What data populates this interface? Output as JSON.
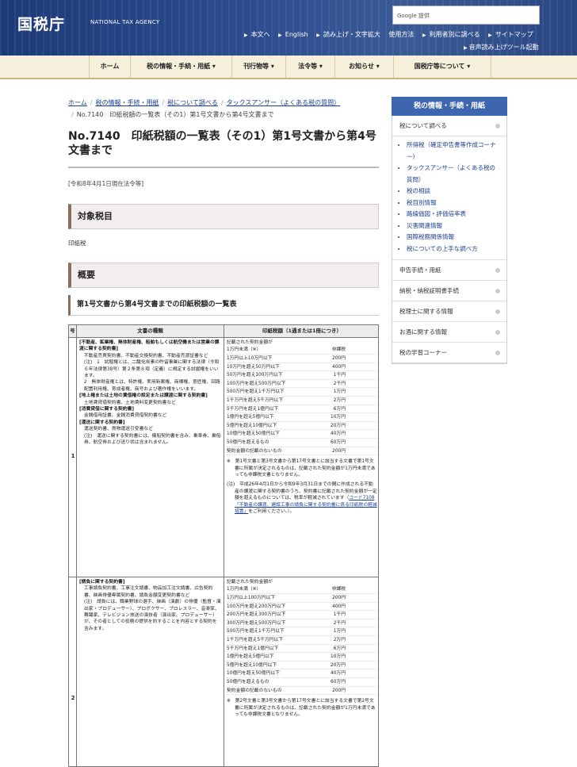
{
  "header": {
    "logo": "国税庁",
    "logo_en": "NATIONAL TAX AGENCY",
    "search_label": "Google 提供",
    "util_links": [
      "本文へ",
      "English",
      "読み上げ・文字拡大",
      "使用方法",
      "利用者別に調べる",
      "サイトマップ"
    ],
    "util_link2": "音声読み上げツール起動"
  },
  "nav": [
    "ホーム",
    "税の情報・手続・用紙",
    "刊行物等",
    "法令等",
    "お知らせ",
    "国税庁等について"
  ],
  "breadcrumb": {
    "items": [
      "ホーム",
      "税の情報・手続・用紙",
      "税について調べる",
      "タックスアンサー（よくある税の質問）"
    ],
    "current": "No.7140　印紙税額の一覧表（その1）第1号文書から第4号文書まで"
  },
  "page": {
    "title": "No.7140　印紙税額の一覧表（その1）第1号文書から第4号文書まで",
    "date": "[令和8年4月1日現在法令等]",
    "h_target": "対象税目",
    "target_value": "印紙税",
    "h_overview": "概要",
    "h3": "第1号文書から第4号文書までの印紙税額の一覧表"
  },
  "table": {
    "headers": [
      "号",
      "文書の種類",
      "印紙税額（1通または1冊につき）"
    ],
    "row1": {
      "no": "1",
      "lines": [
        {
          "t": "[不動産、鉱業権、無体財産権、船舶もしくは航空機または営業の譲渡に関する契約書]",
          "b": true
        },
        {
          "t": "不動産売買契約書、不動産交換契約書、不動産売渡証書など",
          "b": false
        },
        {
          "t": "(注)　1　試掘権とは、二酸化炭素の貯留事業に関する法律（令和６年法律第38号）第２条第８項（定義）に規定する試掘権をいいます。",
          "b": false
        },
        {
          "t": "2　無体財産権とは、特許権、実用新案権、商標権、意匠権、回路配置利用権、育成者権、商号および著作権をいいます。",
          "b": false
        },
        {
          "t": "[地上権または土地の賃借権の設定または譲渡に関する契約書]",
          "b": true
        },
        {
          "t": "土地賃貸借契約書、土地賃料変更契約書など",
          "b": false
        },
        {
          "t": "[消費貸借に関する契約書]",
          "b": true
        },
        {
          "t": "金銭借用証書、金銭消費貸借契約書など",
          "b": false
        },
        {
          "t": "[運送に関する契約書]",
          "b": true
        },
        {
          "t": "運送契約書、貨物運送引受書など",
          "b": false
        },
        {
          "t": "(注)　運送に関する契約書には、傭船契約書を含み、乗車券、乗船券、航空券および送り状は含まれません。",
          "b": false
        }
      ],
      "rates_title": "記載された契約金額が",
      "rates": [
        [
          "1万円未満（※）",
          "非課税"
        ],
        [
          "1万円以上10万円以下",
          "200円"
        ],
        [
          "10万円を超え50万円以下",
          "400円"
        ],
        [
          "50万円を超え100万円以下",
          "1千円"
        ],
        [
          "100万円を超え500万円以下",
          "2千円"
        ],
        [
          "500万円を超え1千万円以下",
          "1万円"
        ],
        [
          "1千万円を超え5千万円以下",
          "2万円"
        ],
        [
          "5千万円を超え1億円以下",
          "6万円"
        ],
        [
          "1億円を超え5億円以下",
          "10万円"
        ],
        [
          "5億円を超え10億円以下",
          "20万円"
        ],
        [
          "10億円を超え50億円以下",
          "40万円"
        ],
        [
          "50億円を超えるもの",
          "60万円"
        ],
        [
          "契約金額の記載のないもの",
          "200円"
        ]
      ],
      "note1": "※　第1号文書と第3号文書から第17号文書とに該当する文書で第1号文書に所属が決定されるものは、記載された契約金額が1万円未満であっても非課税文書となりません。",
      "note2_pre": "(注)　平成26年4月1日から令和9年3月31日までの間に作成される不動産の譲渡に関する契約書のうち、契約書に記載された契約金額が一定額を超えるものについては、税率が軽減されています（",
      "note2_link": "コード7108「不動産の譲渡、建設工事の請負に関する契約書に係る印紙税の軽減措置」",
      "note2_post": "をご利用ください。）。"
    },
    "row2": {
      "no": "2",
      "lines": [
        {
          "t": "[請負に関する契約書]",
          "b": true
        },
        {
          "t": "工事請負契約書、工事注文請書、物品加工注文請書、広告契約書、映画俳優専属契約書、請負金額変更契約書など",
          "b": false
        },
        {
          "t": "(注)　請負には、職業野球の選手、映画（演劇）の俳優（監督・演出家・プロデューサー）、プロボクサー、プロレスラー、音楽家、舞踊家、テレビジョン放送の演技者（演出家、プロデューサー）が、その者としての役務の提供を約することを内容とする契約を含みます。",
          "b": false
        }
      ],
      "rates_title": "記載された契約金額が",
      "rates": [
        [
          "1万円未満（※）",
          "非課税"
        ],
        [
          "1万円以上100万円以下",
          "200円"
        ],
        [
          "100万円を超え200万円以下",
          "400円"
        ],
        [
          "200万円を超え300万円以下",
          "1千円"
        ],
        [
          "300万円を超え500万円以下",
          "2千円"
        ],
        [
          "500万円を超え1千万円以下",
          "1万円"
        ],
        [
          "1千万円を超え5千万円以下",
          "2万円"
        ],
        [
          "5千万円を超え1億円以下",
          "6万円"
        ],
        [
          "1億円を超え5億円以下",
          "10万円"
        ],
        [
          "5億円を超え10億円以下",
          "20万円"
        ],
        [
          "10億円を超え50億円以下",
          "40万円"
        ],
        [
          "50億円を超えるもの",
          "60万円"
        ],
        [
          "契約金額の記載のないもの",
          "200円"
        ]
      ],
      "note1": "※　第2号文書と第3号文書から第17号文書とに該当する文書で第2号文書に所属が決定されるものは、記載された契約金額が1万円未満であっても非課税文書となりません。"
    }
  },
  "sidebar": {
    "title": "税の情報・手続・用紙",
    "section1": "税について調べる",
    "sub": [
      "所得税（確定申告書等作成コーナー）",
      "タックスアンサー（よくある税の質問）",
      "税の相談",
      "税目別情報",
      "路線価図・評価倍率表",
      "災害関連情報",
      "国際税務関係情報",
      "税についての上手な調べ方"
    ],
    "sections": [
      "申告手続・用紙",
      "納税・納税証明書手続",
      "税理士に関する情報",
      "お酒に関する情報",
      "税の学習コーナー"
    ]
  }
}
